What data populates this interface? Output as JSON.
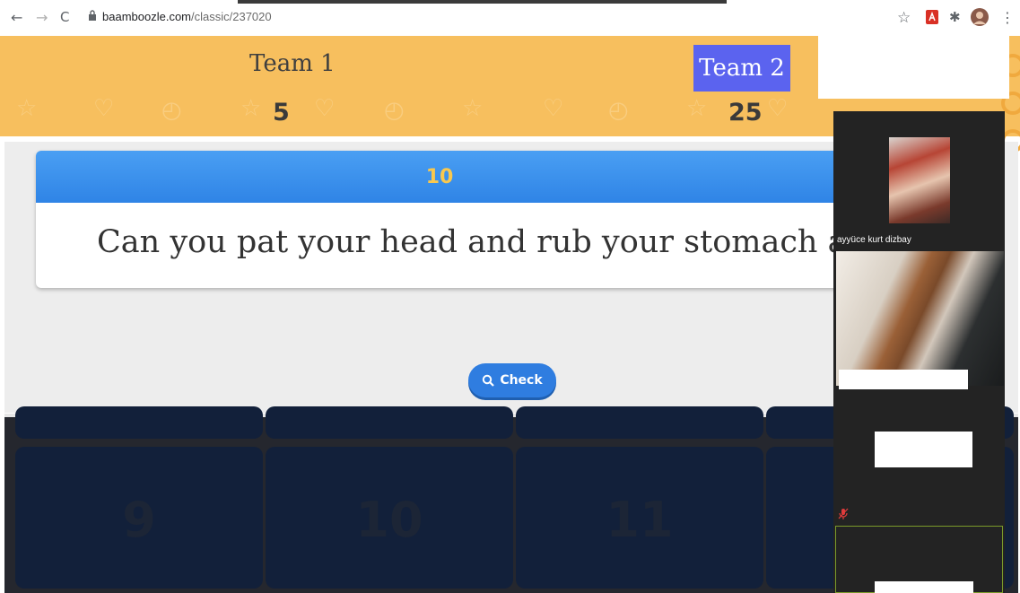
{
  "browser": {
    "url_host": "baamboozle.com",
    "url_path": "/classic/237020",
    "back_glyph": "←",
    "forward_glyph": "→",
    "reload_glyph": "C",
    "star_glyph": "☆",
    "menu_glyph": "⋮",
    "puzzle_glyph": "✱"
  },
  "scoreboard": {
    "team1": {
      "name": "Team 1",
      "score": "5"
    },
    "team2": {
      "name": "Team 2",
      "score": "25",
      "active": true
    }
  },
  "question": {
    "points": "10",
    "text": "Can you pat your head and rub your stomach at the sam"
  },
  "check_button": {
    "label": "Check",
    "icon": "search-icon"
  },
  "board": {
    "tiles": [
      "9",
      "10",
      "11"
    ]
  },
  "participants": {
    "name": "ayyüce kurt dizbay"
  },
  "colors": {
    "header_bg": "#f7bf5e",
    "team2_highlight": "#5b63ef",
    "card_header": "#2f84e6",
    "points_text": "#f9c84e",
    "board_bg": "#25272e",
    "tile_bg": "#12203a"
  }
}
